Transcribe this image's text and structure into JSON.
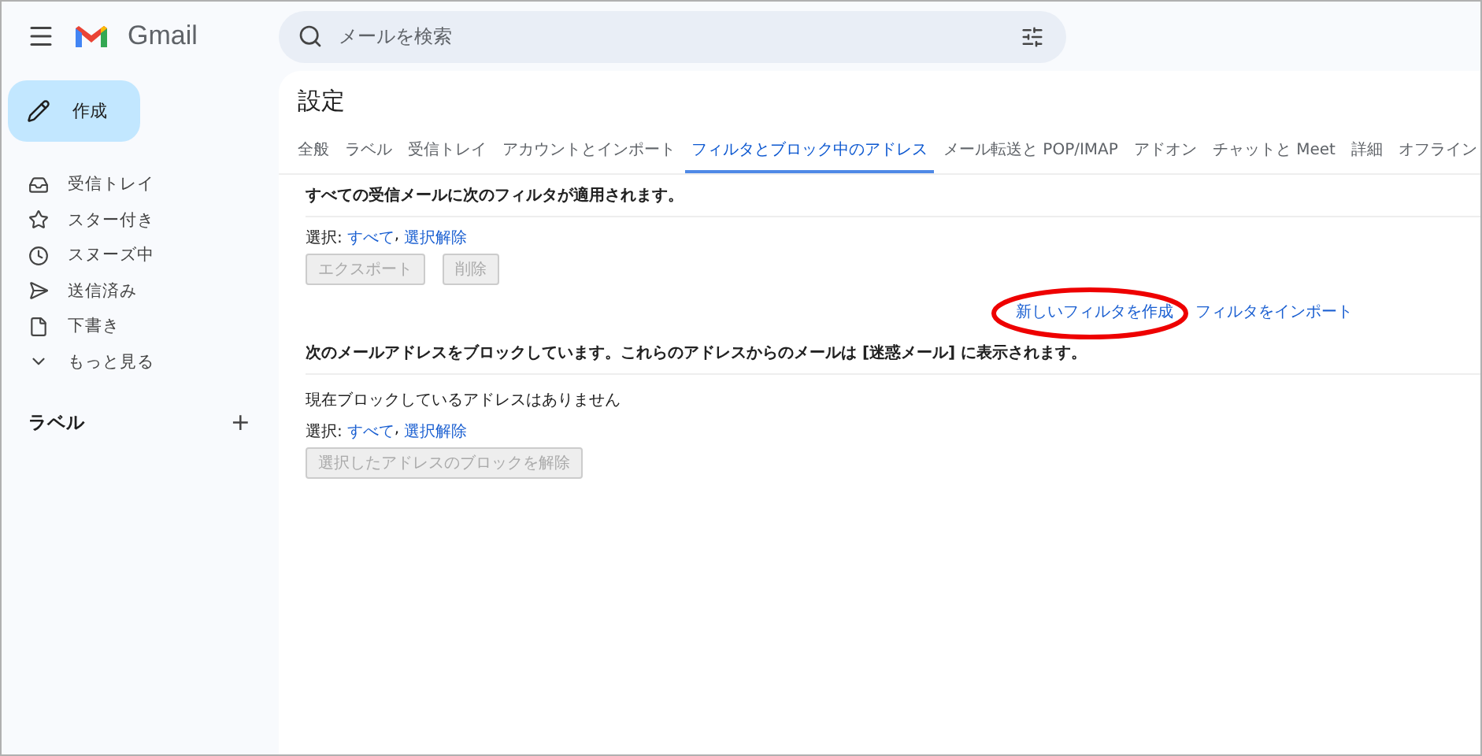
{
  "app": {
    "name": "Gmail"
  },
  "search": {
    "placeholder": "メールを検索"
  },
  "compose": {
    "label": "作成"
  },
  "nav": [
    {
      "label": "受信トレイ",
      "selected": false
    },
    {
      "label": "スター付き",
      "selected": false
    },
    {
      "label": "スヌーズ中",
      "selected": false
    },
    {
      "label": "送信済み",
      "selected": false
    },
    {
      "label": "下書き",
      "selected": false
    },
    {
      "label": "もっと見る",
      "selected": false
    }
  ],
  "labels": {
    "heading": "ラベル",
    "add": "+"
  },
  "settings": {
    "title": "設定",
    "tabs": [
      {
        "label": "全般",
        "selected": false
      },
      {
        "label": "ラベル",
        "selected": false
      },
      {
        "label": "受信トレイ",
        "selected": false
      },
      {
        "label": "アカウントとインポート",
        "selected": false
      },
      {
        "label": "フィルタとブロック中のアドレス",
        "selected": true
      },
      {
        "label": "メール転送と POP/IMAP",
        "selected": false
      },
      {
        "label": "アドオン",
        "selected": false
      },
      {
        "label": "チャットと Meet",
        "selected": false
      },
      {
        "label": "詳細",
        "selected": false
      },
      {
        "label": "オフライン",
        "selected": false
      }
    ],
    "filters": {
      "heading": "すべての受信メールに次のフィルタが適用されます。",
      "select_label": "選択:",
      "select_all": "すべて",
      "separator": ",",
      "select_none": "選択解除",
      "buttons": [
        {
          "label": "エクスポート",
          "disabled": true
        },
        {
          "label": "削除",
          "disabled": true
        }
      ],
      "create_link": {
        "label": "新しいフィルタを作成",
        "circled": true
      },
      "import_link": {
        "label": "フィルタをインポート"
      }
    },
    "blocked": {
      "heading": "次のメールアドレスをブロックしています。これらのアドレスからのメールは [迷惑メール] に表示されます。",
      "empty": "現在ブロックしているアドレスはありません",
      "select_label": "選択:",
      "select_all": "すべて",
      "separator": ",",
      "select_none": "選択解除",
      "buttons": [
        {
          "label": "選択したアドレスのブロックを解除",
          "disabled": true
        }
      ]
    }
  }
}
